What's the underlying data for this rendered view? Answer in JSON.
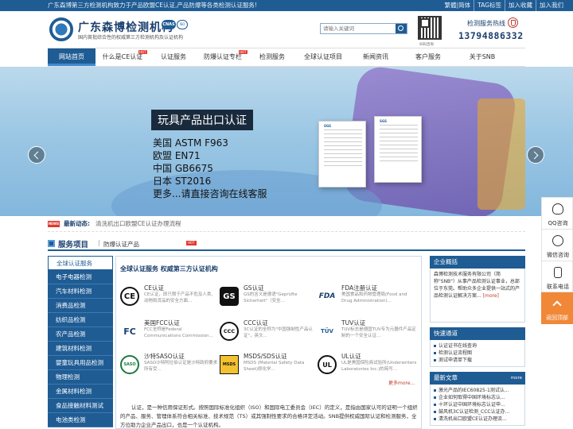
{
  "topbar": {
    "slogan": "广东森博第三方检测机构致力于产品欧盟CE认证,产品防爆等各类检测认证服务!",
    "links": [
      "繁體|简体",
      "TAG标签",
      "加入收藏",
      "加入我们"
    ]
  },
  "header": {
    "brand": "广东森博检测机构",
    "badge1": "CNAS",
    "badge2": "ISO",
    "subtitle": "国内首批综合性的权威第三方检测机构及认证机构",
    "search_placeholder": "请输入关键词",
    "qr_label": "扫码咨询",
    "hotline_label": "检测服务热线",
    "hotline_number": "13794886332"
  },
  "nav": {
    "hot": "HOT",
    "items": [
      {
        "label": "网站首页",
        "active": true,
        "hot": false
      },
      {
        "label": "什么是CE认证",
        "active": false,
        "hot": true
      },
      {
        "label": "认证服务",
        "active": false,
        "hot": false
      },
      {
        "label": "防爆认证专栏",
        "active": false,
        "hot": true
      },
      {
        "label": "检测服务",
        "active": false,
        "hot": false
      },
      {
        "label": "全球认证项目",
        "active": false,
        "hot": false
      },
      {
        "label": "新闻资讯",
        "active": false,
        "hot": false
      },
      {
        "label": "客户服务",
        "active": false,
        "hot": false
      },
      {
        "label": "关于SNB",
        "active": false,
        "hot": false
      }
    ]
  },
  "banner": {
    "title": "玩具产品出口认证",
    "lines": [
      "美国 ASTM F963",
      "欧盟 EN71",
      "中国 GB6675",
      "日本 ST2016",
      "更多...请直接咨询在线客服"
    ],
    "cert_tag1": "SGS",
    "cert_tag2": "SGS"
  },
  "news": {
    "icon": "NEWS",
    "label": "最新动态:",
    "text": "清洗机出口欧盟CE认证办理流程"
  },
  "section": {
    "title": "服务项目",
    "sep": "|",
    "subtitle": "防爆认证产品",
    "hot": "HOT"
  },
  "sidemenu": [
    "全球认证服务",
    "电子电器检测",
    "汽车材料检测",
    "消费品检测",
    "纺织品检测",
    "农产品检测",
    "建筑材料检测",
    "婴童玩具用品检测",
    "物理检测",
    "金属材料检测",
    "食品接触材料测试",
    "电池类检测"
  ],
  "content": {
    "title": "全球认证服务 权威第三方认证机构",
    "certs": [
      {
        "icon": "CE",
        "name": "CE认证",
        "desc": "CE认证，即只限于产品不危及人类、动物和货品的安全方面..."
      },
      {
        "icon": "GS",
        "name": "GS认证",
        "desc": "GS的含义是德语\"Geprüfte Sicherheit\"（安全..."
      },
      {
        "icon": "FDA",
        "name": "FDA注册认证",
        "desc": "美国食品和药物管理局(Food and Drug Administration)..."
      },
      {
        "icon": "FC",
        "name": "美国FCC认证",
        "desc": "FCC全称是Federal Communications Commission..."
      },
      {
        "icon": "CCC",
        "name": "CCC认证",
        "desc": "3C认证的全称为\"中国强制性产品认证\"，英文..."
      },
      {
        "icon": "TÜV",
        "name": "TUV认证",
        "desc": "TUV标志是德国TUV专为元器件产品定制的一个安全认证..."
      },
      {
        "icon": "SASO",
        "name": "沙特SASO认证",
        "desc": "SASO沙特阿拉伯认证是沙特政府要求所有受..."
      },
      {
        "icon": "MSDS",
        "name": "MSDS/SDS认证",
        "desc": "MSDS (Material Safety Data Sheet)即化学..."
      },
      {
        "icon": "UL",
        "name": "UL认证",
        "desc": "UL是美国保险商试验所(Underwriters Laboratories Inc.)的简写..."
      }
    ],
    "more": "更多more...",
    "intro": "认证，是一种信用保证形式。按照国际标准化组织（ISO）和国际电工委员会（IEC）的定义，是指由国家认可的证明一个组织的产品、服务、管理体系符合相关标准、技术规范（TS）或其强制性要求的合格评定活动。SNB提供权威国际认证和检测服务，全方位助力企业产品出口，也是一个认证机构。"
  },
  "right": {
    "about_title": "企业概括",
    "about_text": "森博检测技术服务有限公司（简称\"SNB\"）从事产品检测认证事业，总部位于东莞。帮助众多企业提供一站式的产品检测认证解决方案...",
    "about_more": "[more]",
    "quick_title": "快速通道",
    "quick_items": [
      "认证证书在线查询",
      "检测认证流程图",
      "测试申请单下载"
    ],
    "latest_title": "最新文章",
    "latest_more": "more",
    "latest_items": [
      "激光产品的IEC60825-1测试认...",
      "企业如何取得中国环境标志认...",
      "十环认证中国环境标志认证申...",
      "鼓风机3C认证检测_CCC认证办...",
      "清洗机出口欧盟CE认证办理流..."
    ]
  },
  "float": {
    "items": [
      {
        "icon": "qq-icon",
        "label": "QQ咨询"
      },
      {
        "icon": "wechat-icon",
        "label": "微信咨询"
      },
      {
        "icon": "phone-icon",
        "label": "联系电话"
      },
      {
        "icon": "back-top-icon",
        "label": "返回顶部"
      }
    ]
  }
}
